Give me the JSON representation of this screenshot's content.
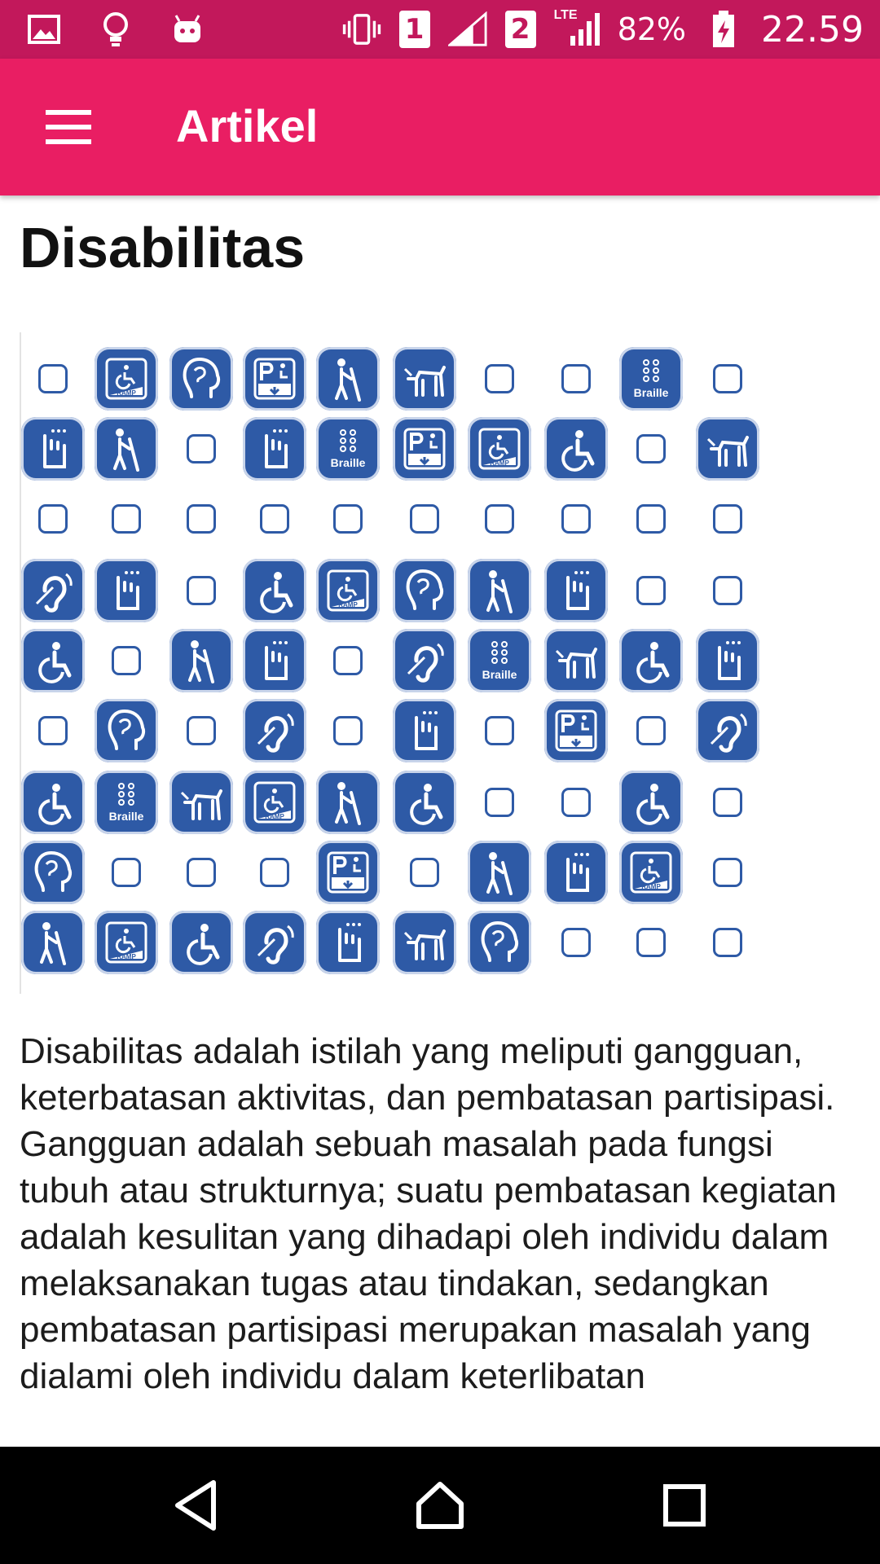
{
  "status_bar": {
    "icons_left": [
      "image-icon",
      "lightbulb-icon",
      "android-icon"
    ],
    "sim1_label": "1",
    "sim2_label": "2",
    "network_label": "LTE",
    "battery_percent": "82%",
    "time": "22.59"
  },
  "app_bar": {
    "title": "Artikel",
    "menu_icon": "hamburger-menu-icon",
    "background_color": "#e91e63"
  },
  "article": {
    "title": "Disabilitas",
    "figure_icons": {
      "braille_label": "Braille",
      "ramp_label": "RAMP",
      "rows": [
        [
          "empty",
          "ramp",
          "head",
          "parking",
          "cane",
          "dog",
          "empty",
          "empty",
          "braille",
          "empty"
        ],
        [
          "hand",
          "cane",
          "empty",
          "hand",
          "braille",
          "parking",
          "ramp",
          "wheelchair",
          "empty",
          "dog"
        ],
        [
          "empty",
          "empty",
          "empty",
          "empty",
          "empty",
          "empty",
          "empty",
          "empty",
          "empty",
          "empty"
        ],
        [
          "ear",
          "hand",
          "empty",
          "wheelchair",
          "ramp",
          "head",
          "cane",
          "hand",
          "empty",
          "empty"
        ],
        [
          "wheelchair",
          "empty",
          "cane",
          "hand",
          "empty",
          "ear",
          "braille",
          "dog",
          "wheelchair",
          "hand"
        ],
        [
          "empty",
          "head",
          "empty",
          "ear",
          "empty",
          "hand",
          "empty",
          "parking",
          "empty",
          "ear"
        ],
        [
          "wheelchair",
          "braille",
          "dog",
          "ramp",
          "cane",
          "wheelchair",
          "empty",
          "empty",
          "wheelchair",
          "empty"
        ],
        [
          "head",
          "empty",
          "empty",
          "empty",
          "parking",
          "empty",
          "cane",
          "hand",
          "ramp",
          "empty"
        ],
        [
          "cane",
          "ramp",
          "wheelchair",
          "ear",
          "hand",
          "dog",
          "head",
          "empty",
          "empty",
          "empty"
        ]
      ]
    },
    "body": "Disabilitas adalah istilah yang meliputi gangguan, keterbatasan aktivitas, dan pembatasan partisipasi. Gangguan adalah sebuah masalah pada fungsi tubuh atau strukturnya; suatu pembatasan kegiatan adalah kesulitan yang dihadapi oleh individu dalam melaksanakan tugas atau tindakan, sedangkan pembatasan partisipasi merupakan masalah yang dialami oleh individu dalam keterlibatan"
  },
  "nav_bar": {
    "buttons": [
      "back-icon",
      "home-icon",
      "recents-icon"
    ]
  }
}
